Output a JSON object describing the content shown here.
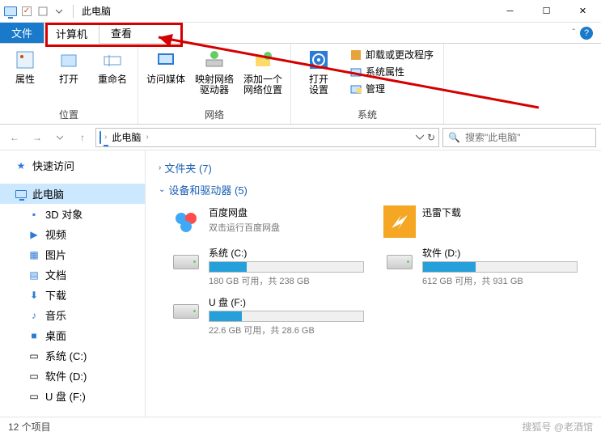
{
  "titlebar": {
    "title": "此电脑"
  },
  "tabs": {
    "file": "文件",
    "computer": "计算机",
    "view": "查看"
  },
  "ribbon": {
    "location": {
      "properties": "属性",
      "open": "打开",
      "rename": "重命名",
      "group": "位置"
    },
    "network": {
      "media": "访问媒体",
      "mapdrive": "映射网络\n驱动器",
      "addloc": "添加一个\n网络位置",
      "group": "网络"
    },
    "system": {
      "opensettings": "打开\n设置",
      "uninstall": "卸载或更改程序",
      "sysprops": "系统属性",
      "manage": "管理",
      "group": "系统"
    }
  },
  "address": {
    "root": "此电脑"
  },
  "search": {
    "placeholder": "搜索\"此电脑\""
  },
  "sidebar": {
    "quick": "快速访问",
    "thispc": "此电脑",
    "items": [
      {
        "label": "3D 对象"
      },
      {
        "label": "视频"
      },
      {
        "label": "图片"
      },
      {
        "label": "文档"
      },
      {
        "label": "下载"
      },
      {
        "label": "音乐"
      },
      {
        "label": "桌面"
      },
      {
        "label": "系统 (C:)"
      },
      {
        "label": "软件 (D:)"
      },
      {
        "label": "U 盘 (F:)"
      }
    ]
  },
  "content": {
    "folders_head": "文件夹 (7)",
    "drives_head": "设备和驱动器 (5)",
    "apps": [
      {
        "name": "百度网盘",
        "sub": "双击运行百度网盘"
      },
      {
        "name": "迅雷下载",
        "sub": ""
      }
    ],
    "drives": [
      {
        "name": "系统 (C:)",
        "stat": "180 GB 可用，共 238 GB",
        "fill": 24
      },
      {
        "name": "软件 (D:)",
        "stat": "612 GB 可用，共 931 GB",
        "fill": 34
      },
      {
        "name": "U 盘 (F:)",
        "stat": "22.6 GB 可用，共 28.6 GB",
        "fill": 21
      }
    ]
  },
  "status": {
    "count": "12 个项目",
    "watermark": "搜狐号 @老酒馆"
  }
}
